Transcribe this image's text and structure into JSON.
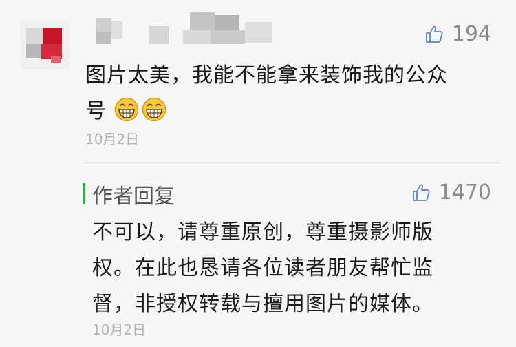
{
  "comment": {
    "likes": "194",
    "text_line1": "图片太美，我能不能拿来装饰我的公众",
    "text_line2": "号",
    "emoji": "grinning-face",
    "date": "10月2日"
  },
  "reply": {
    "label": "作者回复",
    "likes": "1470",
    "text_line1": "不可以，请尊重原创，尊重摄影师版",
    "text_line2": "权。在此也恳请各位读者朋友帮忙监",
    "text_line3": "督，非授权转载与擅用图片的媒体。",
    "date": "10月2日"
  },
  "colors": {
    "accent_green": "#21b44a",
    "muted_gray": "#8a8a8a",
    "date_gray": "#b4b4b4",
    "background": "#f6f6f6"
  }
}
